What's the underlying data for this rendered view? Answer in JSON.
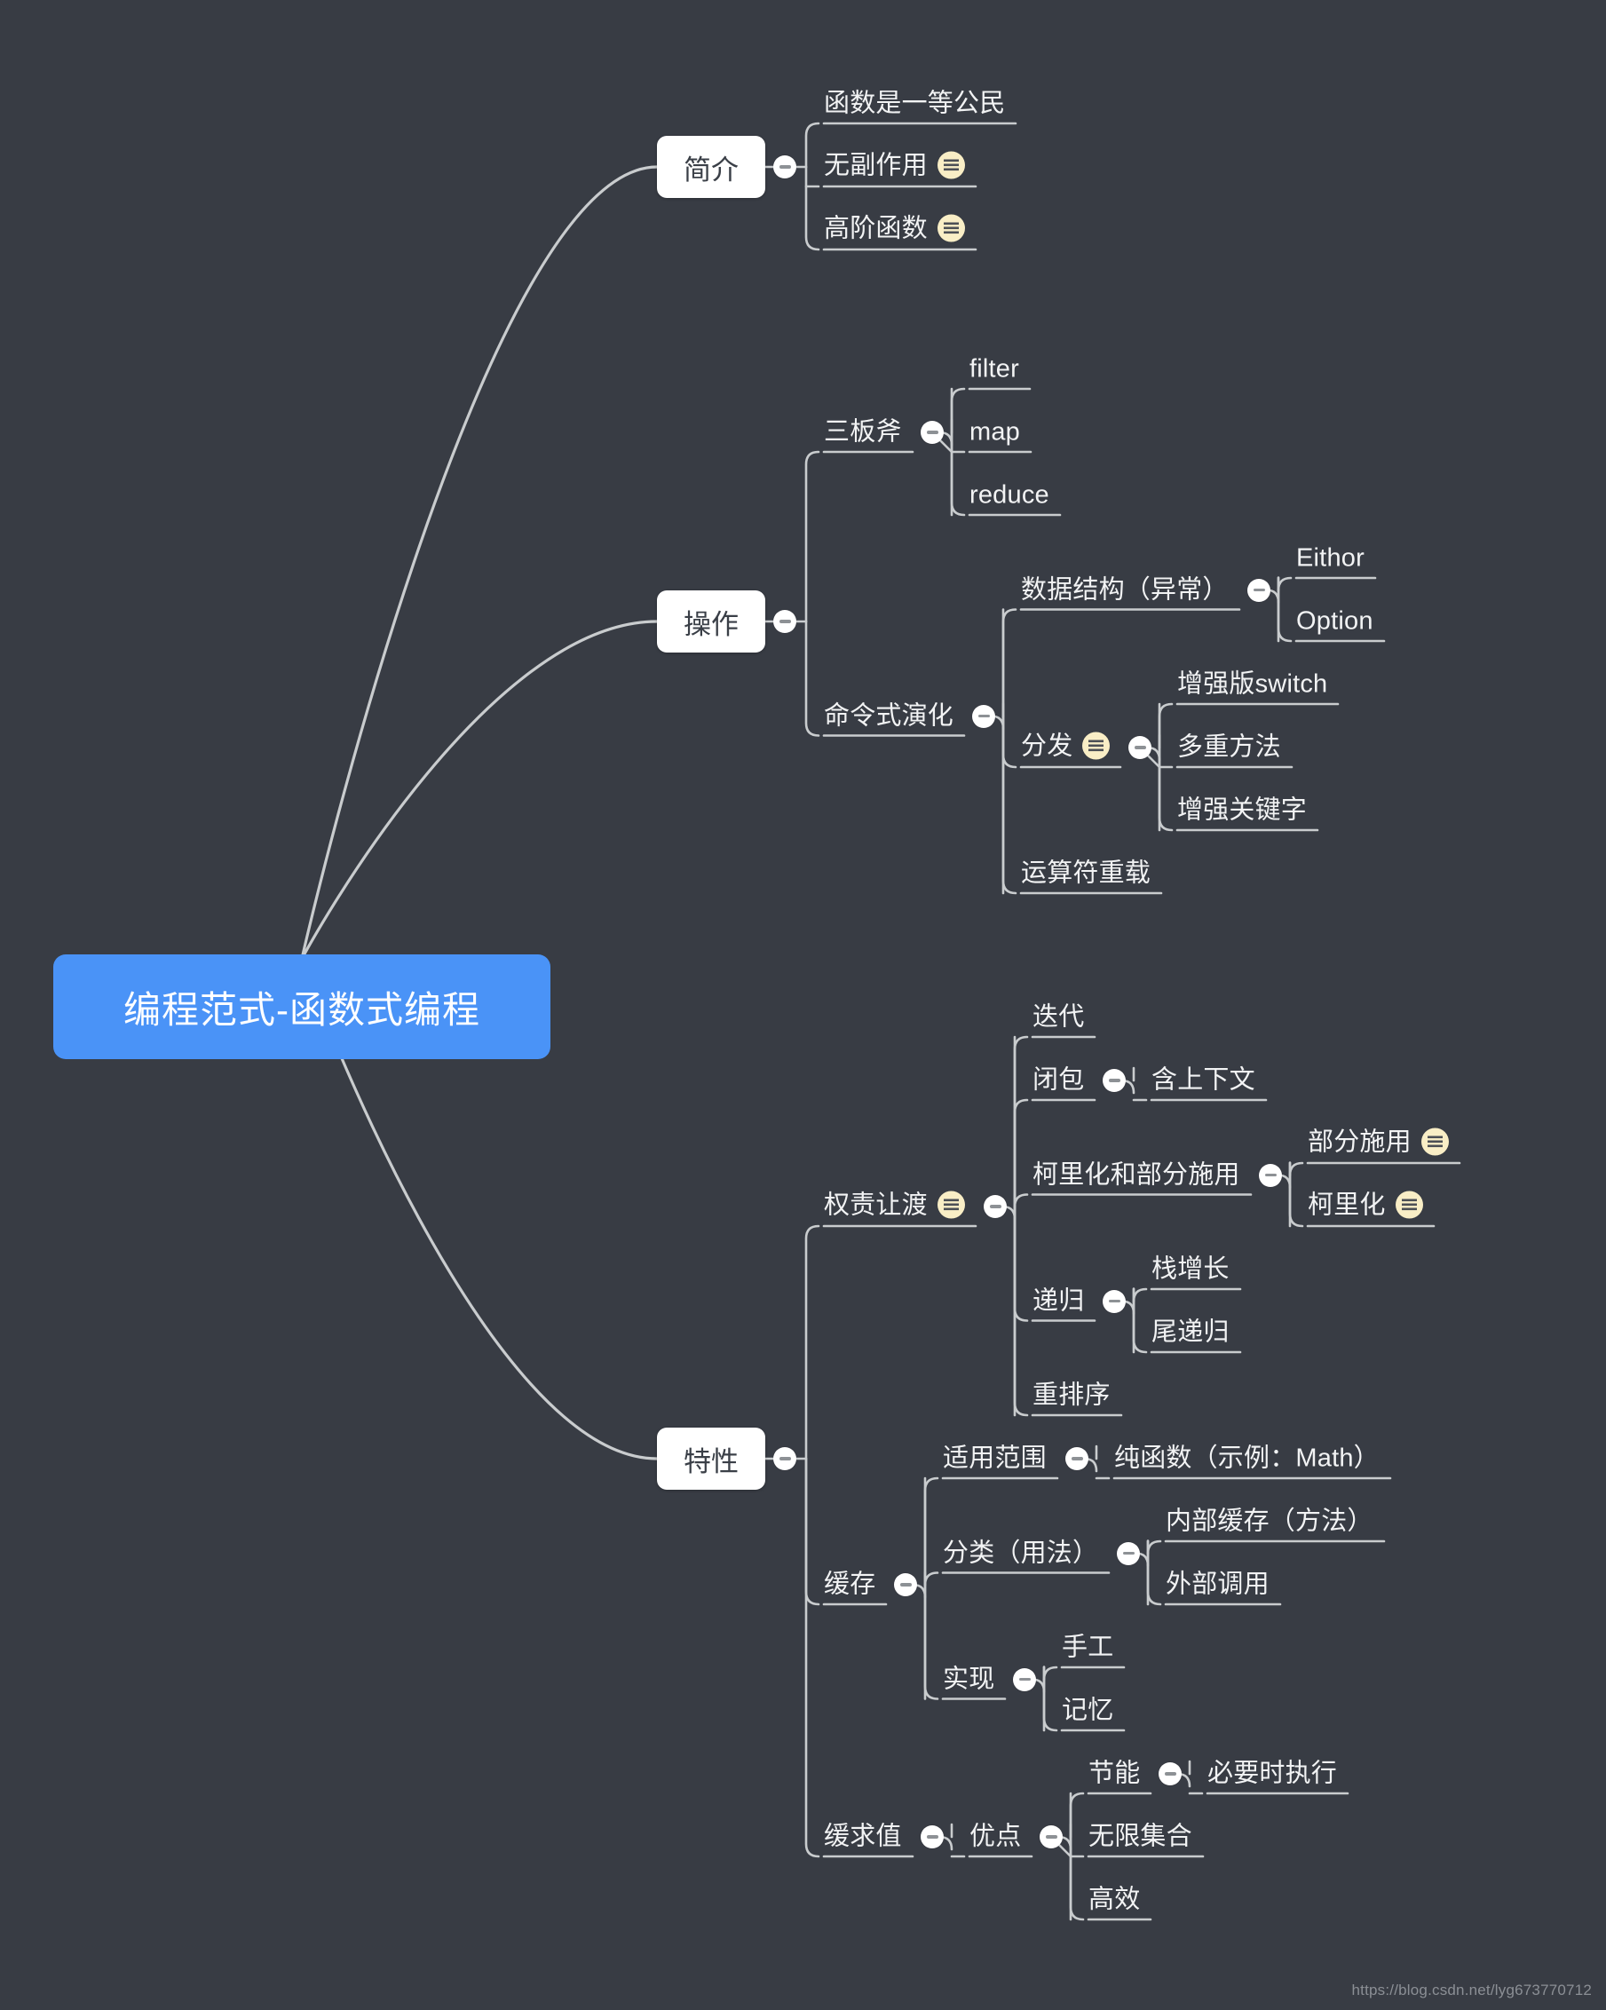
{
  "background_color": "#383c44",
  "root": {
    "label": "编程范式-函数式编程",
    "color": "#4a93f7",
    "text_color": "#ffffff"
  },
  "branches": [
    {
      "label": "简介",
      "children": [
        {
          "label": "函数是一等公民",
          "note": false
        },
        {
          "label": "无副作用",
          "note": true
        },
        {
          "label": "高阶函数",
          "note": true
        }
      ]
    },
    {
      "label": "操作",
      "children": [
        {
          "label": "三板斧",
          "note": false,
          "children": [
            {
              "label": "filter",
              "note": false
            },
            {
              "label": "map",
              "note": false
            },
            {
              "label": "reduce",
              "note": false
            }
          ]
        },
        {
          "label": "命令式演化",
          "note": false,
          "children": [
            {
              "label": "数据结构（异常）",
              "note": false,
              "children": [
                {
                  "label": "Eithor",
                  "note": false
                },
                {
                  "label": "Option",
                  "note": false
                }
              ]
            },
            {
              "label": "分发",
              "note": true,
              "children": [
                {
                  "label": "增强版switch",
                  "note": false
                },
                {
                  "label": "多重方法",
                  "note": false
                },
                {
                  "label": "增强关键字",
                  "note": false
                }
              ]
            },
            {
              "label": "运算符重载",
              "note": false
            }
          ]
        }
      ]
    },
    {
      "label": "特性",
      "children": [
        {
          "label": "权责让渡",
          "note": true,
          "children": [
            {
              "label": "迭代",
              "note": false
            },
            {
              "label": "闭包",
              "note": false,
              "children": [
                {
                  "label": "含上下文",
                  "note": false
                }
              ]
            },
            {
              "label": "柯里化和部分施用",
              "note": false,
              "children": [
                {
                  "label": "部分施用",
                  "note": true
                },
                {
                  "label": "柯里化",
                  "note": true
                }
              ]
            },
            {
              "label": "递归",
              "note": false,
              "children": [
                {
                  "label": "栈增长",
                  "note": false
                },
                {
                  "label": "尾递归",
                  "note": false
                }
              ]
            },
            {
              "label": "重排序",
              "note": false
            }
          ]
        },
        {
          "label": "缓存",
          "note": false,
          "children": [
            {
              "label": "适用范围",
              "note": false,
              "children": [
                {
                  "label": "纯函数（示例：Math）",
                  "note": false
                }
              ]
            },
            {
              "label": "分类（用法）",
              "note": false,
              "children": [
                {
                  "label": "内部缓存（方法）",
                  "note": false
                },
                {
                  "label": "外部调用",
                  "note": false
                }
              ]
            },
            {
              "label": "实现",
              "note": false,
              "children": [
                {
                  "label": "手工",
                  "note": false
                },
                {
                  "label": "记忆",
                  "note": false
                }
              ]
            }
          ]
        },
        {
          "label": "缓求值",
          "note": false,
          "children": [
            {
              "label": "优点",
              "note": false,
              "children": [
                {
                  "label": "节能",
                  "note": false,
                  "children": [
                    {
                      "label": "必要时执行",
                      "note": false
                    }
                  ]
                },
                {
                  "label": "无限集合",
                  "note": false
                },
                {
                  "label": "高效",
                  "note": false
                }
              ]
            }
          ]
        }
      ]
    }
  ],
  "watermark": "https://blog.csdn.net/lyg673770712"
}
